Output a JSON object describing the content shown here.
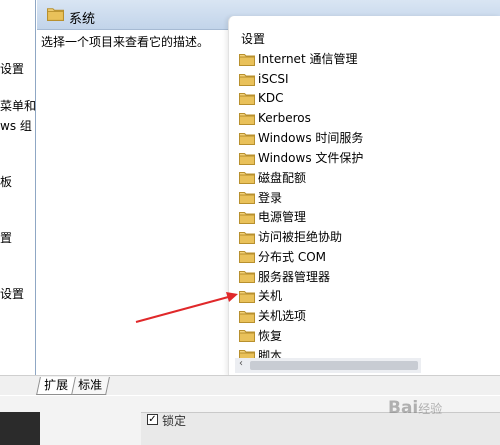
{
  "left_pane": {
    "items": [
      "设置",
      "菜单和",
      "ws 组",
      "板",
      "置",
      "设置"
    ]
  },
  "header": {
    "title": "系统",
    "icon": "folder-icon"
  },
  "main": {
    "description": "选择一个项目来查看它的描述。"
  },
  "list": {
    "column_header": "设置",
    "items": [
      "Internet 通信管理",
      "iSCSI",
      "KDC",
      "Kerberos",
      "Windows 时间服务",
      "Windows 文件保护",
      "磁盘配额",
      "登录",
      "电源管理",
      "访问被拒绝协助",
      "分布式 COM",
      "服务器管理器",
      "关机",
      "关机选项",
      "恢复",
      "脚本"
    ]
  },
  "tabs": [
    "扩展",
    "标准"
  ],
  "bottom": {
    "checkbox_label": "锁定"
  },
  "watermark": {
    "text": "Bai",
    "sub": "经验"
  },
  "colors": {
    "folder": "#e9c15a",
    "annotation_arrow": "#e0282a",
    "header": "#c9d9ee"
  }
}
